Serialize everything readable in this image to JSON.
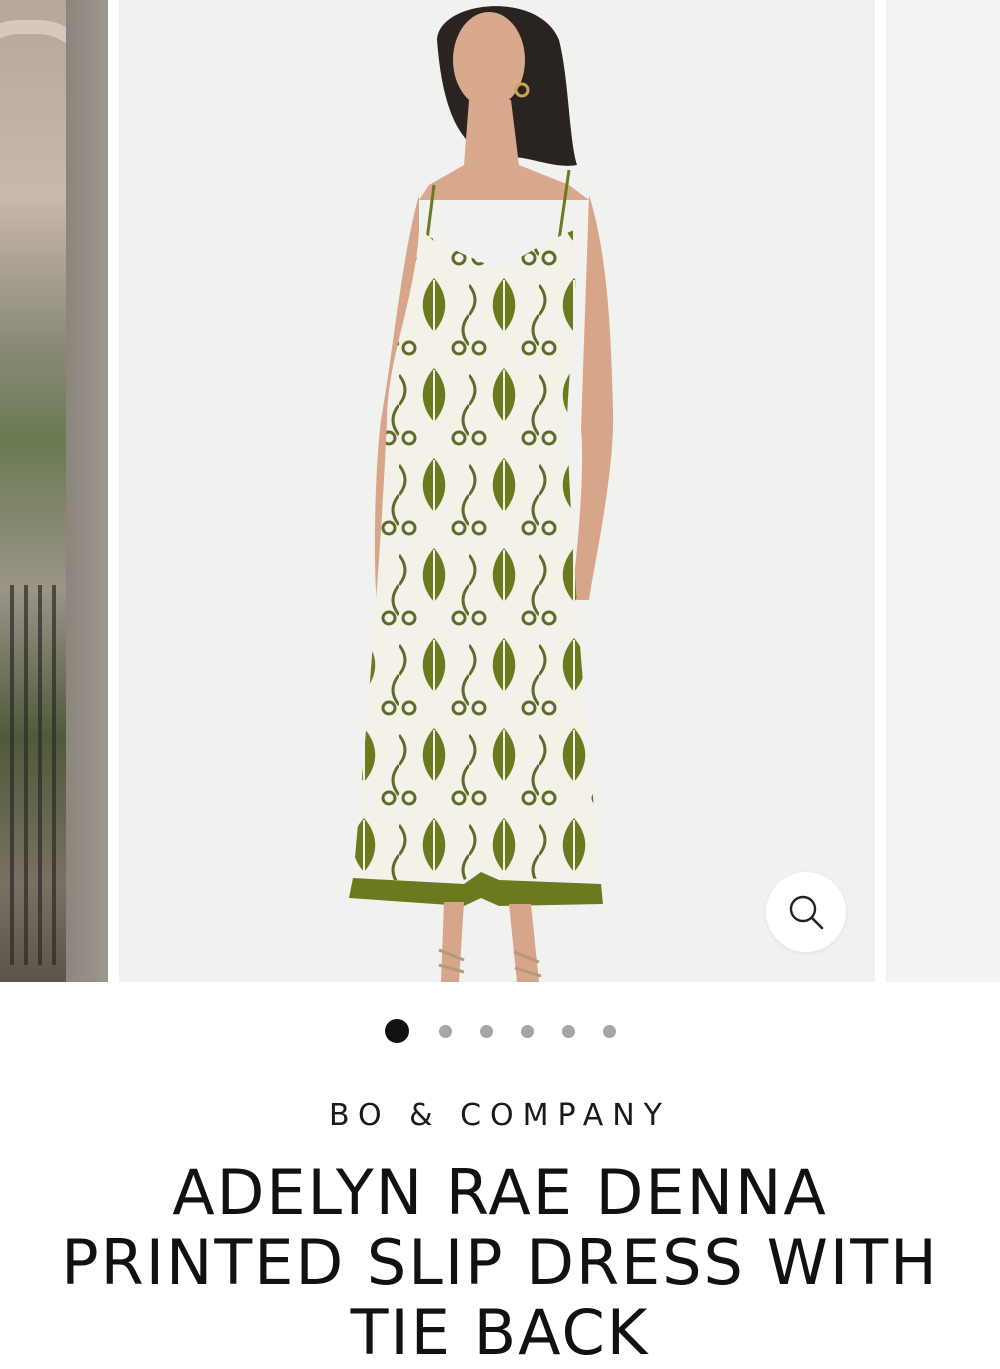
{
  "product": {
    "brand": "BO & COMPANY",
    "title": "ADELYN RAE DENNA PRINTED SLIP DRESS WITH TIE BACK"
  },
  "gallery": {
    "total_images": 6,
    "active_index": 0,
    "zoom_icon": "search-icon"
  },
  "colors": {
    "accent_text": "#111111",
    "dot_active": "#111111",
    "dot_inactive": "#a6a6a6",
    "print_green": "#6b7a1f"
  }
}
